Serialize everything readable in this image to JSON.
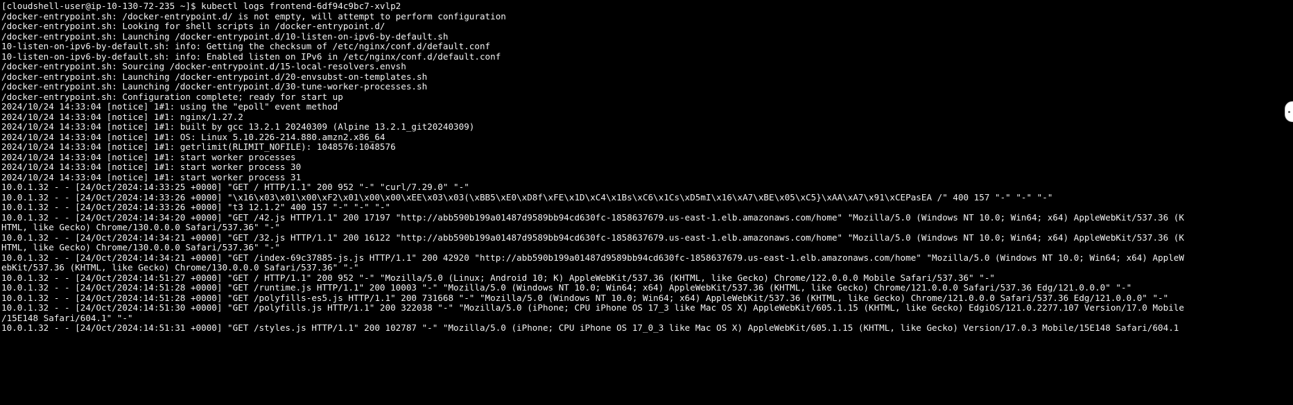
{
  "terminal": {
    "lines": [
      "[cloudshell-user@ip-10-130-72-235 ~]$ kubectl logs frontend-6df94c9bc7-xvlp2",
      "/docker-entrypoint.sh: /docker-entrypoint.d/ is not empty, will attempt to perform configuration",
      "/docker-entrypoint.sh: Looking for shell scripts in /docker-entrypoint.d/",
      "/docker-entrypoint.sh: Launching /docker-entrypoint.d/10-listen-on-ipv6-by-default.sh",
      "10-listen-on-ipv6-by-default.sh: info: Getting the checksum of /etc/nginx/conf.d/default.conf",
      "10-listen-on-ipv6-by-default.sh: info: Enabled listen on IPv6 in /etc/nginx/conf.d/default.conf",
      "/docker-entrypoint.sh: Sourcing /docker-entrypoint.d/15-local-resolvers.envsh",
      "/docker-entrypoint.sh: Launching /docker-entrypoint.d/20-envsubst-on-templates.sh",
      "/docker-entrypoint.sh: Launching /docker-entrypoint.d/30-tune-worker-processes.sh",
      "/docker-entrypoint.sh: Configuration complete; ready for start up",
      "2024/10/24 14:33:04 [notice] 1#1: using the \"epoll\" event method",
      "2024/10/24 14:33:04 [notice] 1#1: nginx/1.27.2",
      "2024/10/24 14:33:04 [notice] 1#1: built by gcc 13.2.1 20240309 (Alpine 13.2.1_git20240309)",
      "2024/10/24 14:33:04 [notice] 1#1: OS: Linux 5.10.226-214.880.amzn2.x86_64",
      "2024/10/24 14:33:04 [notice] 1#1: getrlimit(RLIMIT_NOFILE): 1048576:1048576",
      "2024/10/24 14:33:04 [notice] 1#1: start worker processes",
      "2024/10/24 14:33:04 [notice] 1#1: start worker process 30",
      "2024/10/24 14:33:04 [notice] 1#1: start worker process 31",
      "10.0.1.32 - - [24/Oct/2024:14:33:25 +0000] \"GET / HTTP/1.1\" 200 952 \"-\" \"curl/7.29.0\" \"-\"",
      "10.0.1.32 - - [24/Oct/2024:14:33:26 +0000] \"\\x16\\x03\\x01\\x00\\xF2\\x01\\x00\\x00\\xEE\\x03\\x03(\\xBB5\\xE0\\xD8f\\xFE\\x1D\\xC4\\x1Bs\\xC6\\x1Cs\\xD5mI\\x16\\xA7\\xBE\\x05\\xC5}\\xAA\\xA7\\x91\\xCEPasEA /\" 400 157 \"-\" \"-\" \"-\"",
      "10.0.1.32 - - [24/Oct/2024:14:33:26 +0000] \"t3 12.1.2\" 400 157 \"-\" \"-\" \"-\"",
      "10.0.1.32 - - [24/Oct/2024:14:34:20 +0000] \"GET /42.js HTTP/1.1\" 200 17197 \"http://abb590b199a01487d9589bb94cd630fc-1858637679.us-east-1.elb.amazonaws.com/home\" \"Mozilla/5.0 (Windows NT 10.0; Win64; x64) AppleWebKit/537.36 (K",
      "HTML, like Gecko) Chrome/130.0.0.0 Safari/537.36\" \"-\"",
      "10.0.1.32 - - [24/Oct/2024:14:34:21 +0000] \"GET /32.js HTTP/1.1\" 200 16122 \"http://abb590b199a01487d9589bb94cd630fc-1858637679.us-east-1.elb.amazonaws.com/home\" \"Mozilla/5.0 (Windows NT 10.0; Win64; x64) AppleWebKit/537.36 (K",
      "HTML, like Gecko) Chrome/130.0.0.0 Safari/537.36\" \"-\"",
      "10.0.1.32 - - [24/Oct/2024:14:34:21 +0000] \"GET /index-69c37885-js.js HTTP/1.1\" 200 42920 \"http://abb590b199a01487d9589bb94cd630fc-1858637679.us-east-1.elb.amazonaws.com/home\" \"Mozilla/5.0 (Windows NT 10.0; Win64; x64) AppleW",
      "ebKit/537.36 (KHTML, like Gecko) Chrome/130.0.0.0 Safari/537.36\" \"-\"",
      "10.0.1.32 - - [24/Oct/2024:14:51:27 +0000] \"GET / HTTP/1.1\" 200 952 \"-\" \"Mozilla/5.0 (Linux; Android 10; K) AppleWebKit/537.36 (KHTML, like Gecko) Chrome/122.0.0.0 Mobile Safari/537.36\" \"-\"",
      "10.0.1.32 - - [24/Oct/2024:14:51:28 +0000] \"GET /runtime.js HTTP/1.1\" 200 10003 \"-\" \"Mozilla/5.0 (Windows NT 10.0; Win64; x64) AppleWebKit/537.36 (KHTML, like Gecko) Chrome/121.0.0.0 Safari/537.36 Edg/121.0.0.0\" \"-\"",
      "10.0.1.32 - - [24/Oct/2024:14:51:28 +0000] \"GET /polyfills-es5.js HTTP/1.1\" 200 731668 \"-\" \"Mozilla/5.0 (Windows NT 10.0; Win64; x64) AppleWebKit/537.36 (KHTML, like Gecko) Chrome/121.0.0.0 Safari/537.36 Edg/121.0.0.0\" \"-\"",
      "10.0.1.32 - - [24/Oct/2024:14:51:30 +0000] \"GET /polyfills.js HTTP/1.1\" 200 322038 \"-\" \"Mozilla/5.0 (iPhone; CPU iPhone OS 17_3 like Mac OS X) AppleWebKit/605.1.15 (KHTML, like Gecko) EdgiOS/121.0.2277.107 Version/17.0 Mobile",
      "/15E148 Safari/604.1\" \"-\"",
      "10.0.1.32 - - [24/Oct/2024:14:51:31 +0000] \"GET /styles.js HTTP/1.1\" 200 102787 \"-\" \"Mozilla/5.0 (iPhone; CPU iPhone OS 17_0_3 like Mac OS X) AppleWebKit/605.1.15 (KHTML, like Gecko) Version/17.0.3 Mobile/15E148 Safari/604.1"
    ]
  },
  "colors": {
    "background": "#000000",
    "text": "#f2f2f2"
  },
  "icons": {
    "scroll_handle": "scroll-handle-icon"
  }
}
